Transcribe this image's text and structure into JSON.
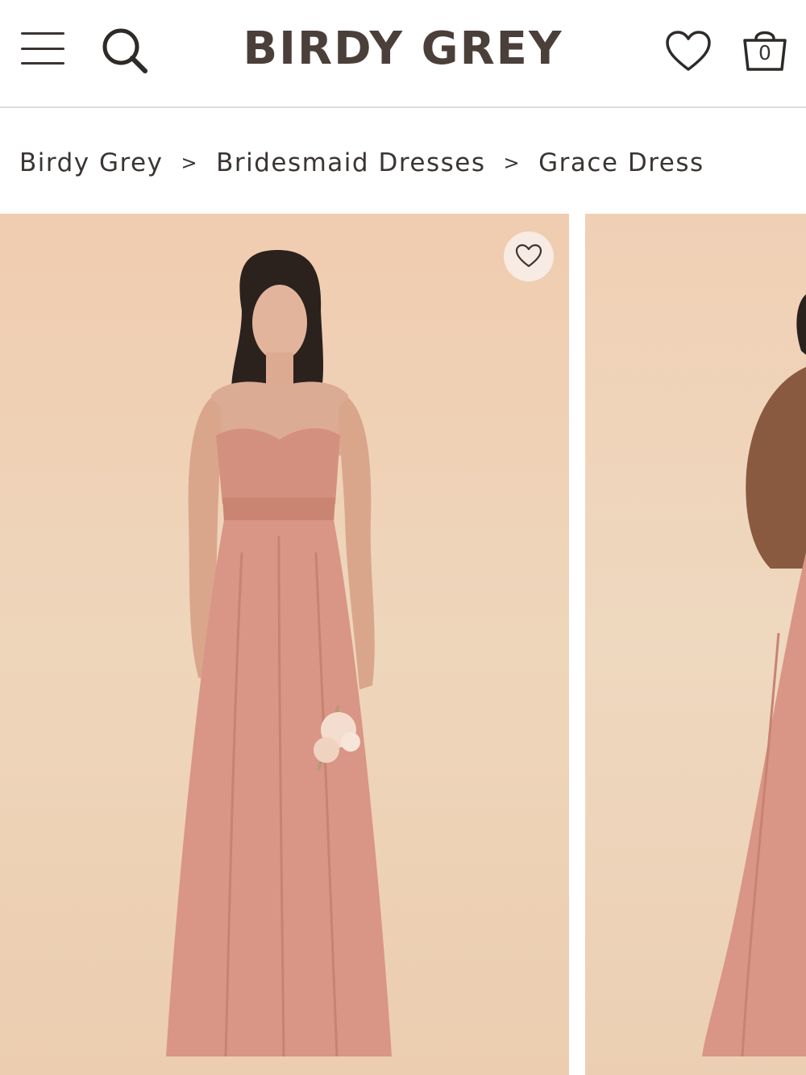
{
  "header": {
    "logo": "BIRDY GREY",
    "menu_icon": "hamburger-menu-icon",
    "search_icon": "search-icon",
    "wishlist_icon": "heart-icon",
    "bag_icon": "shopping-bag-icon",
    "bag_count": "0"
  },
  "breadcrumb": {
    "items": [
      {
        "label": "Birdy Grey"
      },
      {
        "label": "Bridesmaid Dresses"
      },
      {
        "label": "Grace Dress"
      }
    ],
    "separator": ">"
  },
  "gallery": {
    "favorite_icon": "heart-icon",
    "colors": {
      "background": "#eed6bb",
      "dress": "#d99585",
      "text": "#3a3532"
    }
  }
}
